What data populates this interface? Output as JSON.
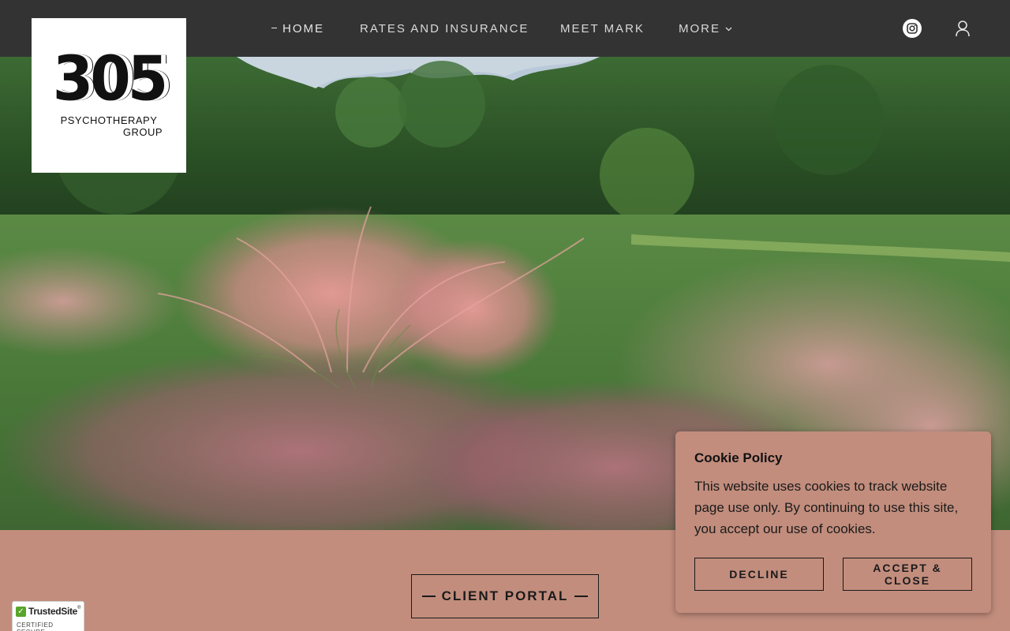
{
  "nav": {
    "home": "HOME",
    "rates": "RATES AND INSURANCE",
    "meet": "MEET MARK",
    "more": "MORE",
    "more_chevron": "⌄"
  },
  "header": {
    "instagram_icon": "instagram-icon",
    "account_icon": "user-icon"
  },
  "logo": {
    "number": "305",
    "line1": "PSYCHOTHERAPY",
    "line2": "GROUP"
  },
  "hero": {
    "image": "pink-muhly-grass-field-photo"
  },
  "portal": {
    "label": "CLIENT PORTAL"
  },
  "cookie": {
    "title": "Cookie Policy",
    "body": "This website uses cookies to track website page use only. By continuing to use this site, you accept our use of cookies.",
    "decline": "DECLINE",
    "accept_line1": "ACCEPT &",
    "accept_line2": "CLOSE"
  },
  "trusted": {
    "name": "TrustedSite",
    "tm": "®",
    "sub": "CERTIFIED SECURE"
  },
  "colors": {
    "header_bg": "#333333",
    "band_bg": "#c28d7d",
    "accent_green": "#58a52b"
  }
}
